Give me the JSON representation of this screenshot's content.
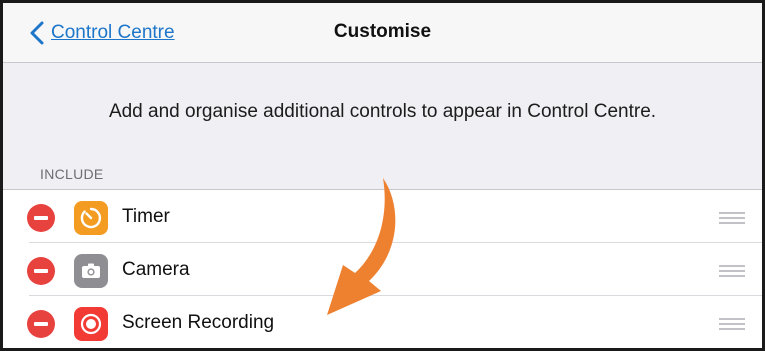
{
  "navbar": {
    "back_label": "Control Centre",
    "title": "Customise"
  },
  "description": "Add and organise additional controls to appear in Control Centre.",
  "section": {
    "header": "INCLUDE",
    "items": [
      {
        "label": "Timer",
        "icon": "timer-icon",
        "icon_bg": "#f49c22"
      },
      {
        "label": "Camera",
        "icon": "camera-icon",
        "icon_bg": "#8e8e93"
      },
      {
        "label": "Screen Recording",
        "icon": "screen-recording-icon",
        "icon_bg": "#f23b34"
      }
    ]
  },
  "colors": {
    "accent": "#1d76c9",
    "delete": "#e8423f",
    "annotation_arrow": "#ee8130"
  }
}
